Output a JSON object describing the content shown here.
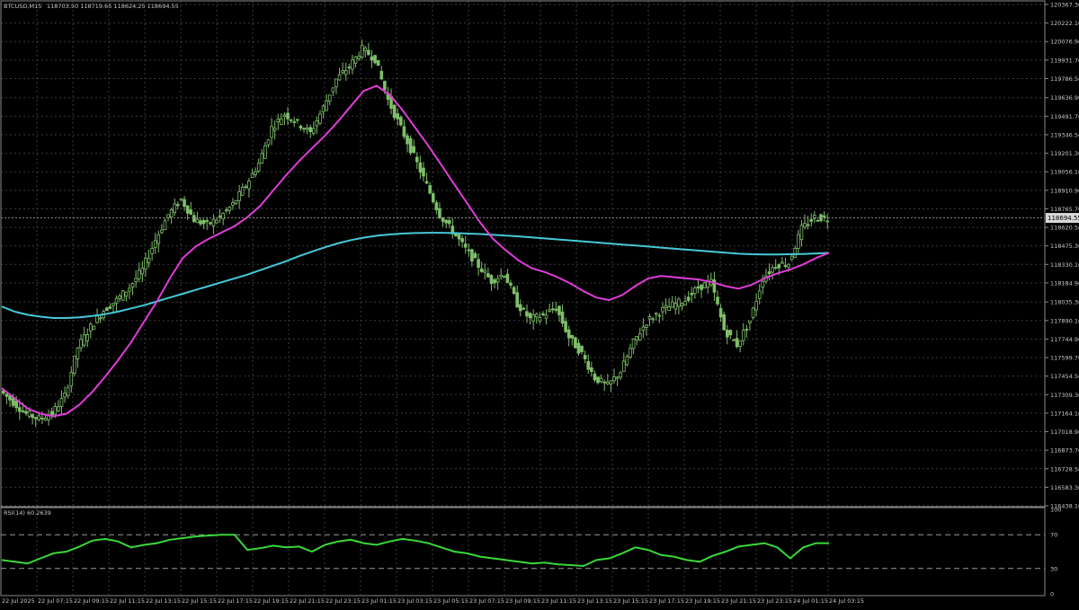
{
  "header": {
    "symbol_tf": "BTCUSD,M15",
    "ohlc": "118703.50 118719.65 118624.25 118694.55"
  },
  "current_price": "118694.55",
  "colors": {
    "background": "#000000",
    "grid": "#3a3a3a",
    "text": "#c8c8c8",
    "candle": "#7fbf6a",
    "ma_fast": "#e03cd8",
    "ma_slow": "#48c8d8",
    "rsi_line": "#38d838",
    "frame": "#8a8a8a"
  },
  "price_axis_labels": [
    "120367.30",
    "120222.10",
    "120076.90",
    "119931.70",
    "119786.50",
    "119636.90",
    "119491.70",
    "119346.50",
    "119201.30",
    "119056.10",
    "118910.90",
    "118765.70",
    "118620.50",
    "118475.30",
    "118330.10",
    "118184.90",
    "118035.30",
    "117890.10",
    "117744.90",
    "117599.70",
    "117454.50",
    "117309.30",
    "117164.10",
    "117018.90",
    "116873.70",
    "116728.50",
    "116583.30",
    "116438.10"
  ],
  "time_axis_labels": [
    "22 Jul 2025",
    "22 Jul 07:15",
    "22 Jul 09:15",
    "22 Jul 11:15",
    "22 Jul 13:15",
    "22 Jul 15:15",
    "22 Jul 17:15",
    "22 Jul 19:15",
    "22 Jul 21:15",
    "22 Jul 23:15",
    "23 Jul 01:15",
    "23 Jul 03:15",
    "23 Jul 05:15",
    "23 Jul 07:15",
    "23 Jul 09:15",
    "23 Jul 11:15",
    "23 Jul 13:15",
    "23 Jul 15:15",
    "23 Jul 17:15",
    "23 Jul 19:15",
    "23 Jul 21:15",
    "23 Jul 23:15",
    "24 Jul 01:15",
    "24 Jul 03:15"
  ],
  "rsi": {
    "label": "RSI(14) 60.2639",
    "levels": [
      70,
      30
    ],
    "axis_labels": [
      "100",
      "70",
      "30",
      "0"
    ]
  },
  "chart_data": {
    "type": "line",
    "ylim": [
      116438.1,
      120367.3
    ],
    "series": [
      {
        "values": [
          117340,
          117250,
          117160,
          117120,
          117160,
          117300,
          117680,
          117840,
          117970,
          118050,
          118150,
          118290,
          118520,
          118720,
          118840,
          118680,
          118640,
          118700,
          118800,
          118950,
          119120,
          119400,
          119510,
          119440,
          119360,
          119560,
          119780,
          119880,
          120020,
          119940,
          119620,
          119400,
          119180,
          118950,
          118720,
          118590,
          118450,
          118320,
          118200,
          118260,
          118020,
          117900,
          117930,
          117990,
          117760,
          117630,
          117440,
          117380,
          117490,
          117720,
          117880,
          117960,
          118010,
          118050,
          118150,
          118190,
          117820,
          117700,
          117890,
          118220,
          118330,
          118340,
          118610,
          118700,
          118690
        ]
      },
      {
        "values": [
          117360,
          117280,
          117200,
          117160,
          117140,
          117160,
          117230,
          117330,
          117450,
          117580,
          117720,
          117880,
          118040,
          118220,
          118380,
          118470,
          118530,
          118580,
          118630,
          118700,
          118790,
          118910,
          119030,
          119140,
          119240,
          119340,
          119450,
          119570,
          119690,
          119730,
          119660,
          119540,
          119400,
          119260,
          119110,
          118960,
          118810,
          118660,
          118530,
          118440,
          118360,
          118300,
          118270,
          118230,
          118180,
          118120,
          118070,
          118050,
          118090,
          118160,
          118220,
          118240,
          118230,
          118220,
          118210,
          118190,
          118160,
          118140,
          118170,
          118220,
          118260,
          118290,
          118330,
          118380,
          118420
        ]
      },
      {
        "values": [
          118000,
          117960,
          117935,
          117920,
          117910,
          117910,
          117915,
          117925,
          117940,
          117960,
          117985,
          118010,
          118040,
          118070,
          118100,
          118130,
          118160,
          118190,
          118220,
          118250,
          118285,
          118320,
          118355,
          118395,
          118430,
          118465,
          118495,
          118520,
          118540,
          118555,
          118565,
          118572,
          118576,
          118578,
          118578,
          118576,
          118572,
          118568,
          118562,
          118556,
          118550,
          118542,
          118534,
          118526,
          118518,
          118510,
          118502,
          118494,
          118486,
          118478,
          118470,
          118462,
          118454,
          118446,
          118438,
          118430,
          118422,
          118414,
          118410,
          118408,
          118408,
          118410,
          118412,
          118416,
          118420
        ]
      },
      {
        "values": [
          40,
          38,
          36,
          42,
          48,
          50,
          56,
          63,
          65,
          62,
          55,
          58,
          60,
          64,
          66,
          68,
          69,
          70,
          70,
          52,
          54,
          57,
          55,
          56,
          50,
          58,
          62,
          64,
          60,
          58,
          62,
          65,
          63,
          60,
          55,
          50,
          48,
          44,
          42,
          40,
          38,
          36,
          37,
          35,
          34,
          33,
          40,
          42,
          48,
          55,
          52,
          46,
          44,
          40,
          38,
          45,
          50,
          56,
          58,
          60,
          55,
          42,
          55,
          60,
          60
        ]
      }
    ]
  }
}
